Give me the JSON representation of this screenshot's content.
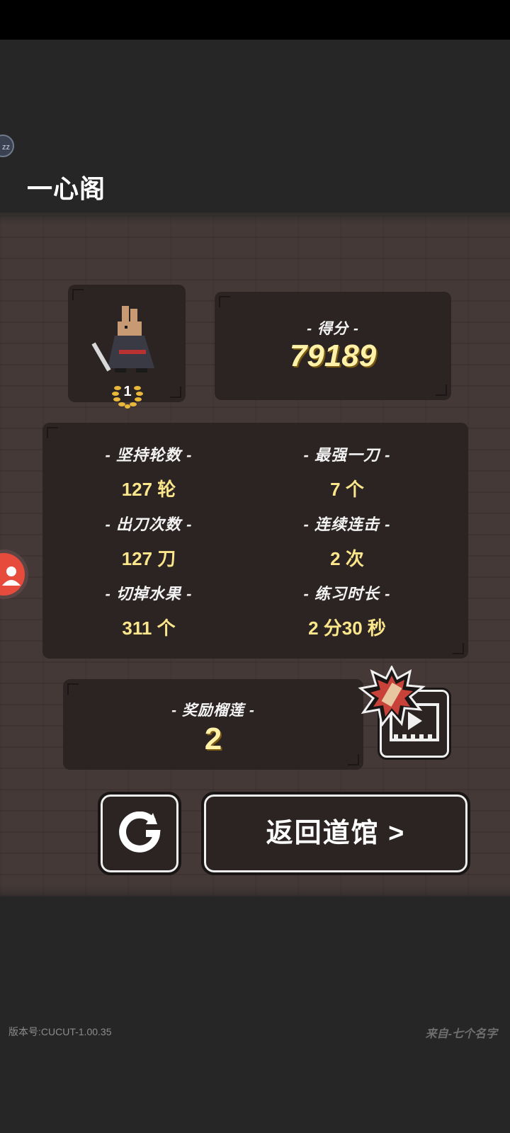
{
  "header": {
    "title": "一心阁",
    "badge": "zz"
  },
  "player": {
    "rank": "1"
  },
  "score": {
    "label": "- 得分 -",
    "value": "79189"
  },
  "stats": [
    {
      "label": "- 坚持轮数 -",
      "value": "127 轮"
    },
    {
      "label": "- 最强一刀 -",
      "value": "7 个"
    },
    {
      "label": "- 出刀次数 -",
      "value": "127 刀"
    },
    {
      "label": "- 连续连击 -",
      "value": "2 次"
    },
    {
      "label": "- 切掉水果 -",
      "value": "311 个"
    },
    {
      "label": "- 练习时长 -",
      "value": "2 分30 秒"
    }
  ],
  "reward": {
    "label": "- 奖励榴莲 -",
    "value": "2"
  },
  "buttons": {
    "home_label": "返回道馆 >"
  },
  "footer": {
    "version": "版本号:CUCUT-1.00.35",
    "credit": "来自-七个名字"
  },
  "colors": {
    "panel": "#453938",
    "card": "#2b2423",
    "value_yellow": "#fbe68b",
    "accent_red": "#e64b3c"
  },
  "icons": [
    "ninja-rabbit-avatar",
    "laurel-rank-icon",
    "video-play-icon",
    "burst-bonus-icon",
    "restart-icon",
    "user-icon"
  ]
}
